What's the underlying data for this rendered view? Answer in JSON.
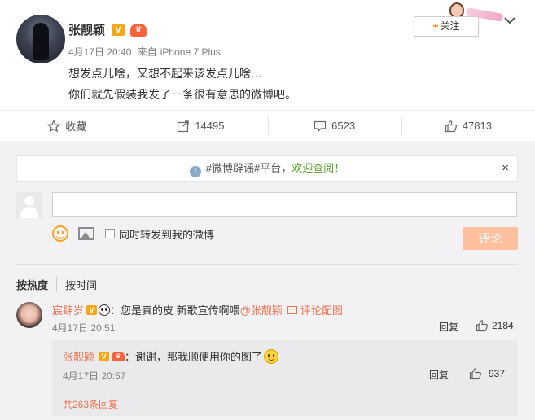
{
  "post": {
    "author_name": "张靓颖",
    "verified_badge": "V",
    "member_badge": "会员",
    "date": "4月17日 20:40",
    "source_prefix": "来自",
    "source": "iPhone 7 Plus",
    "text_line1": "想发点儿啥，又想不起来该发点儿啥…",
    "text_line2": "你们就先假装我发了一条很有意思的微博吧。",
    "follow_plus": "+",
    "follow_label": "关注"
  },
  "actions": {
    "favorite_label": "收藏",
    "repost_count": "14495",
    "comment_count": "6523",
    "like_count": "47813"
  },
  "notice": {
    "icon": "!",
    "text_prefix": "#微博辟谣#平台，",
    "text_highlight": "欢迎查阅！",
    "close": "×"
  },
  "composer": {
    "repost_label": "同时转发到我的微博",
    "submit_label": "评论"
  },
  "sort_tabs": [
    "按热度",
    "按时间"
  ],
  "comment": {
    "user_name": "宸肆岁",
    "verified_badge": "V",
    "text": "：您是真的皮 新歌宣传啊喂",
    "mention": "@张靓颖",
    "pic_label": "评论配图",
    "time": "4月17日 20:51",
    "reply_label": "回复",
    "like_count": "2184"
  },
  "sub_reply": {
    "user_name": "张靓颖",
    "verified_badge": "V",
    "member_badge": "会员",
    "text": "：谢谢，那我顺便用你的图了",
    "time": "4月17日 20:57",
    "reply_label": "回复",
    "like_count": "937",
    "more_replies": "共263条回复"
  },
  "colors": {
    "accent": "#ff8200",
    "link": "#eb7350",
    "submit_disabled": "#ffc09f",
    "highlight_green": "#5aa02c",
    "comment_bg": "#f2f2f5"
  }
}
